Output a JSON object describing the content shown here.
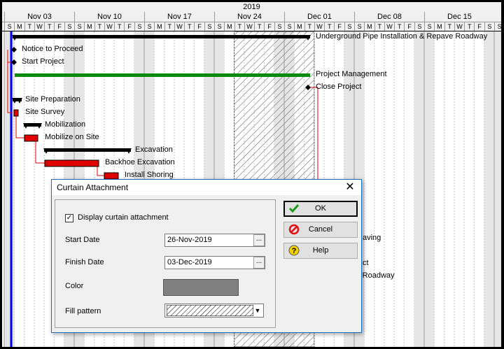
{
  "timeline": {
    "year": "2019",
    "weeks": [
      "Nov 03",
      "Nov 10",
      "Nov 17",
      "Nov 24",
      "Dec 01",
      "Dec 08",
      "Dec 15"
    ],
    "day_letters": [
      "S",
      "M",
      "T",
      "W",
      "T",
      "F",
      "S"
    ]
  },
  "tasks": [
    {
      "label": "Underground Pipe Installation & Repave Roadway"
    },
    {
      "label": "Notice to Proceed"
    },
    {
      "label": "Start Project"
    },
    {
      "label": "Project Management"
    },
    {
      "label": "Close Project"
    },
    {
      "label": "Site Preparation"
    },
    {
      "label": "Site Survey"
    },
    {
      "label": "Mobilization"
    },
    {
      "label": "Mobilize on Site"
    },
    {
      "label": "Excavation"
    },
    {
      "label": "Backhoe Excavation"
    },
    {
      "label": "Install Shoring"
    },
    {
      "label": "aving"
    },
    {
      "label": "ct"
    },
    {
      "label": "ce Roadway"
    }
  ],
  "curtain": {
    "start_date": "26-Nov-2019",
    "finish_date": "03-Dec-2019",
    "color": "#808080"
  },
  "dialog": {
    "title": "Curtain Attachment",
    "display_checkbox_label": "Display curtain attachment",
    "display_checked": true,
    "start_date_label": "Start Date",
    "start_date_value": "26-Nov-2019",
    "finish_date_label": "Finish Date",
    "finish_date_value": "03-Dec-2019",
    "color_label": "Color",
    "fill_pattern_label": "Fill pattern",
    "ellipsis": "...",
    "ok_label": "OK",
    "cancel_label": "Cancel",
    "help_label": "Help"
  }
}
